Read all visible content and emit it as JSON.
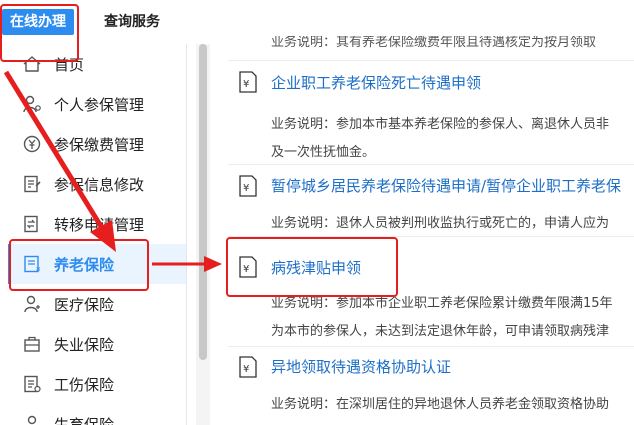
{
  "topbar": {
    "tabs": [
      {
        "label": "在线办理",
        "active": true
      },
      {
        "label": "查询服务",
        "active": false
      }
    ]
  },
  "sidebar": {
    "items": [
      {
        "label": "首页",
        "icon": "home-icon"
      },
      {
        "label": "个人参保管理",
        "icon": "user-gear-icon"
      },
      {
        "label": "参保缴费管理",
        "icon": "payment-icon"
      },
      {
        "label": "参保信息修改",
        "icon": "edit-document-icon"
      },
      {
        "label": "转移申请管理",
        "icon": "transfer-icon"
      },
      {
        "label": "养老保险",
        "icon": "pension-document-icon",
        "active": true
      },
      {
        "label": "医疗保险",
        "icon": "medical-user-icon"
      },
      {
        "label": "失业保险",
        "icon": "briefcase-icon"
      },
      {
        "label": "工伤保险",
        "icon": "injury-document-icon"
      },
      {
        "label": "生育保险",
        "icon": "maternity-icon"
      }
    ]
  },
  "content": {
    "partial_top_desc": "业务说明：其有养老保险缴费年限且待遇核定为按月领取",
    "services": [
      {
        "title": "企业职工养老保险死亡待遇申领",
        "desc_lines": [
          "业务说明：参加本市基本养老保险的参保人、离退休人员非",
          "及一次性抚恤金。"
        ]
      },
      {
        "title": "暂停城乡居民养老保险待遇申请/暂停企业职工养老保",
        "desc_lines": [
          "业务说明：退休人员被判刑收监执行或死亡的，申请人应为"
        ]
      },
      {
        "title": "病残津贴申领",
        "desc_lines": [
          "业务说明：参加本市企业职工养老保险累计缴费年限满15年",
          "为本市的参保人，未达到法定退休年龄，可申请领取病残津"
        ]
      },
      {
        "title": "异地领取待遇资格协助认证",
        "desc_lines": [
          "业务说明：在深圳居住的异地退休人员养老金领取资格协助"
        ]
      }
    ]
  },
  "colors": {
    "accent": "#2d8cf0",
    "link": "#1d6fc7",
    "annotation_red": "#e61e1e"
  }
}
